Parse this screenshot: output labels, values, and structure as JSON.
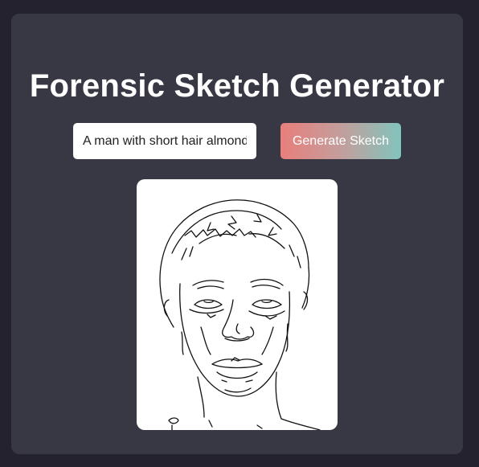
{
  "page": {
    "title": "Forensic Sketch Generator"
  },
  "form": {
    "prompt_value": "A man with short hair almond shaped eyes",
    "generate_label": "Generate Sketch"
  },
  "result": {
    "image_alt": "Generated forensic sketch of a man's face"
  },
  "colors": {
    "page_background": "#24222e",
    "card_background": "#383844",
    "button_gradient_start": "#e97f7c",
    "button_gradient_end": "#82c4bd"
  }
}
